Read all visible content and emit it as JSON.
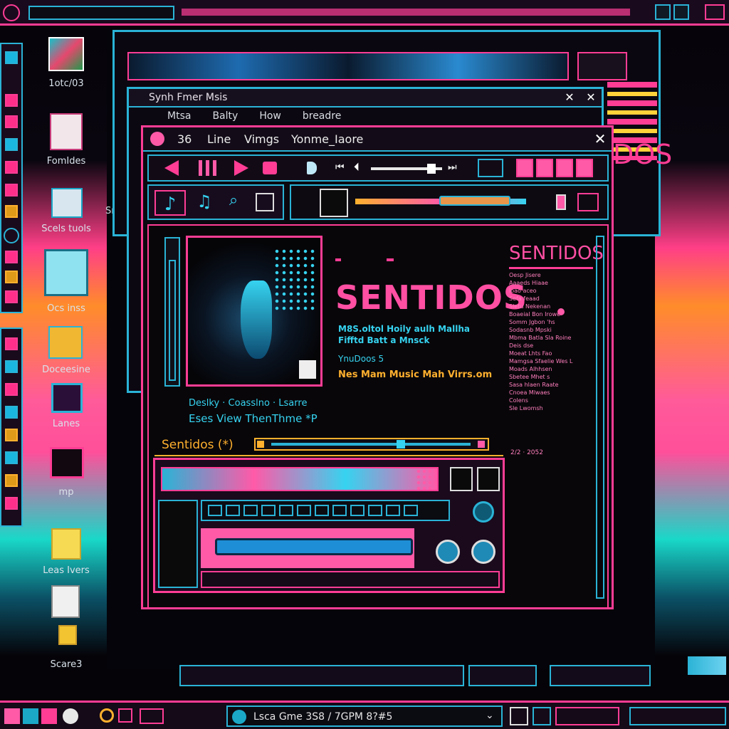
{
  "colors": {
    "accent_pink": "#ff3d95",
    "accent_cyan": "#2ab3d6",
    "accent_orange": "#ffb02e",
    "background": "#07050a"
  },
  "desktop": {
    "icons": [
      {
        "label": "1otc/03",
        "icon": "image-icon"
      },
      {
        "label": "FomIdes",
        "icon": "document-icon"
      },
      {
        "label": "Scels tuols",
        "icon": "tools-icon"
      },
      {
        "label": "Ocs inss",
        "icon": "folder-icon"
      },
      {
        "label": "Doceesine",
        "icon": "stamp-icon"
      },
      {
        "label": "Lanes",
        "icon": "window-icon"
      },
      {
        "label": "mp",
        "icon": "image-icon"
      },
      {
        "label": "Leas Ivers",
        "icon": "folder-icon"
      },
      {
        "label": "",
        "icon": "file-icon"
      },
      {
        "label": "Scare3",
        "icon": "folder-icon"
      }
    ],
    "partial_label": "Sm",
    "bg_window_title": "DOS"
  },
  "back_window": {
    "title": "Synh Fmer Msis",
    "menu": [
      "Mtsa",
      "Balty",
      "How",
      "breadre"
    ]
  },
  "player": {
    "menu": [
      "36",
      "Line",
      "Vimgs",
      "Yonme_Iaore"
    ],
    "track_title": "SENTIDOS",
    "artist_line1": "M8S.oltol Hoily aulh Mallha",
    "artist_line2": "Fifftd Batt a Mnsck",
    "sub_info": "YnuDoos 5",
    "credits": "Nes Mam Music Mah Virrs.om",
    "caption_line1": "Deslky · Coasslno · Lsarre",
    "caption_line2": "Eses View ThenThme *P",
    "now_playing": "Sentidos (*)",
    "progress": 0.65,
    "seek_position": 0.85,
    "balance_position": 0.7,
    "sidebar": {
      "title": "SENTIDOS",
      "lines": [
        "Oesp Jisere",
        "Aaaeds Hiaae",
        "loao aceo",
        "Sefa feaad",
        "Sletu Nekenan",
        "Boaeial Bon Irowe",
        "Somm Jgbon 'hs",
        "Sodasnb Mpski",
        "Mbma Batla Sla Roine",
        "Deis dse",
        "Moeat Lhts Fao",
        "Mamgsa Sfaelie Wes L",
        "Moads Alhhsen",
        "Sbetee Mhet s",
        "Sasa hlaen Raate",
        "Cnoea Mlwaes",
        "Colens",
        "Sle Lwomsh"
      ],
      "footer": "2/2 · 2052"
    },
    "transport_labels": [
      "prev",
      "pause",
      "play",
      "record",
      "volume"
    ]
  },
  "taskbar": {
    "now_playing": "Lsca Gme 3S8 / 7GPM 8?#5"
  }
}
